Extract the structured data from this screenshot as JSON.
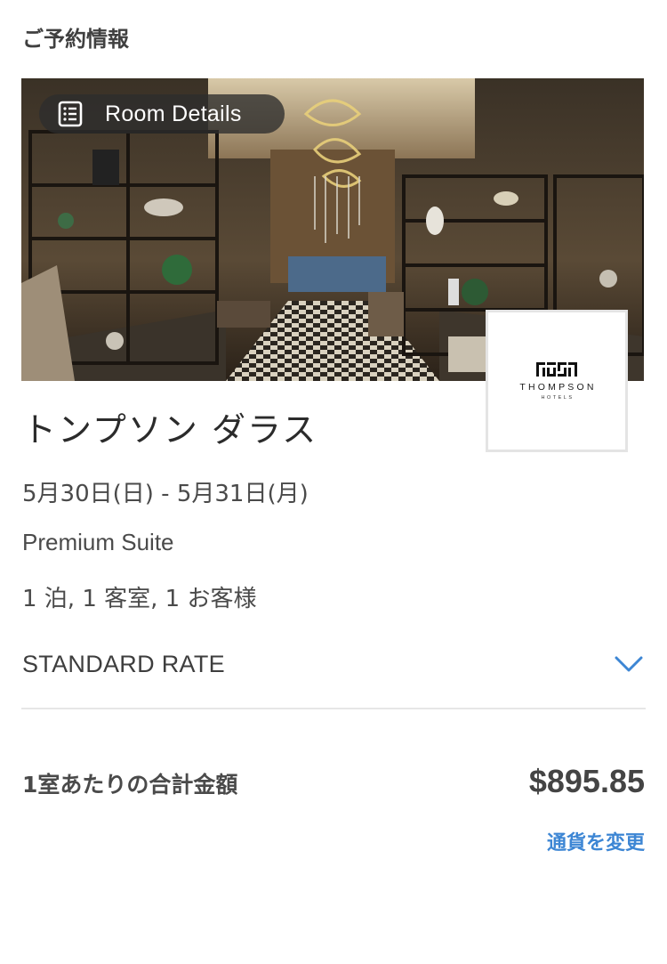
{
  "section": {
    "title": "ご予約情報"
  },
  "hero": {
    "room_details_label": "Room Details",
    "room_details_icon": "list-document-icon"
  },
  "logo": {
    "name": "THOMPSON",
    "sub": "HOTELS"
  },
  "hotel": {
    "name": "トンプソン ダラス"
  },
  "stay": {
    "dates": "5月30日(日) - 5月31日(月)",
    "room_type": "Premium Suite",
    "guests": "1 泊, 1 客室, 1 お客様"
  },
  "rate": {
    "label": "STANDARD RATE",
    "icon": "chevron-down-icon"
  },
  "total": {
    "label": "1室あたりの合計金額",
    "amount": "$895.85"
  },
  "currency": {
    "change_label": "通貨を変更"
  },
  "colors": {
    "link": "#3d86d4",
    "text": "#3a3a3a",
    "divider": "#e6e6e6"
  }
}
